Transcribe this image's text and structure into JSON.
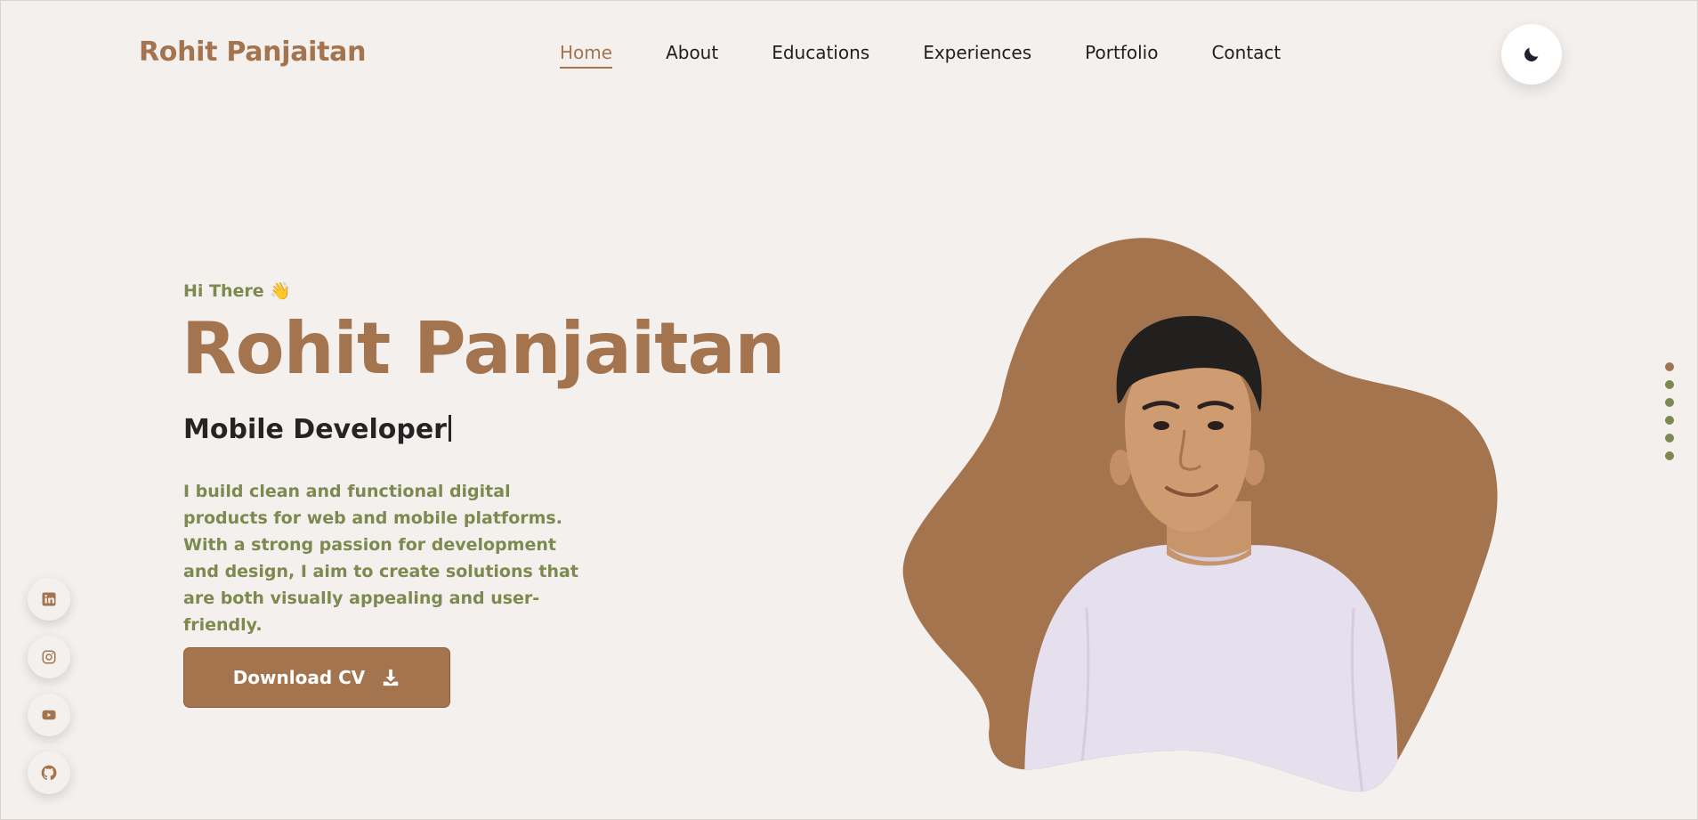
{
  "header": {
    "logo": "Rohit Panjaitan",
    "nav": [
      {
        "label": "Home",
        "active": true
      },
      {
        "label": "About",
        "active": false
      },
      {
        "label": "Educations",
        "active": false
      },
      {
        "label": "Experiences",
        "active": false
      },
      {
        "label": "Portfolio",
        "active": false
      },
      {
        "label": "Contact",
        "active": false
      }
    ],
    "theme_toggle_icon": "moon-icon"
  },
  "hero": {
    "greeting": "Hi There 👋",
    "name": "Rohit Panjaitan",
    "role": "Mobile Developer",
    "description": "I build clean and functional digital products for web and mobile platforms. With a strong passion for development and design, I aim to create solutions that are both visually appealing and user-friendly.",
    "cta_label": "Download CV",
    "cta_icon": "download-icon"
  },
  "social": [
    {
      "icon": "linkedin-icon"
    },
    {
      "icon": "instagram-icon"
    },
    {
      "icon": "youtube-icon"
    },
    {
      "icon": "github-icon"
    }
  ],
  "section_dots": {
    "count": 6,
    "active_index": 0
  },
  "colors": {
    "background": "#f4f0ed",
    "accent_brown": "#a4744f",
    "accent_olive": "#7c8a4f",
    "text_dark": "#242424"
  }
}
